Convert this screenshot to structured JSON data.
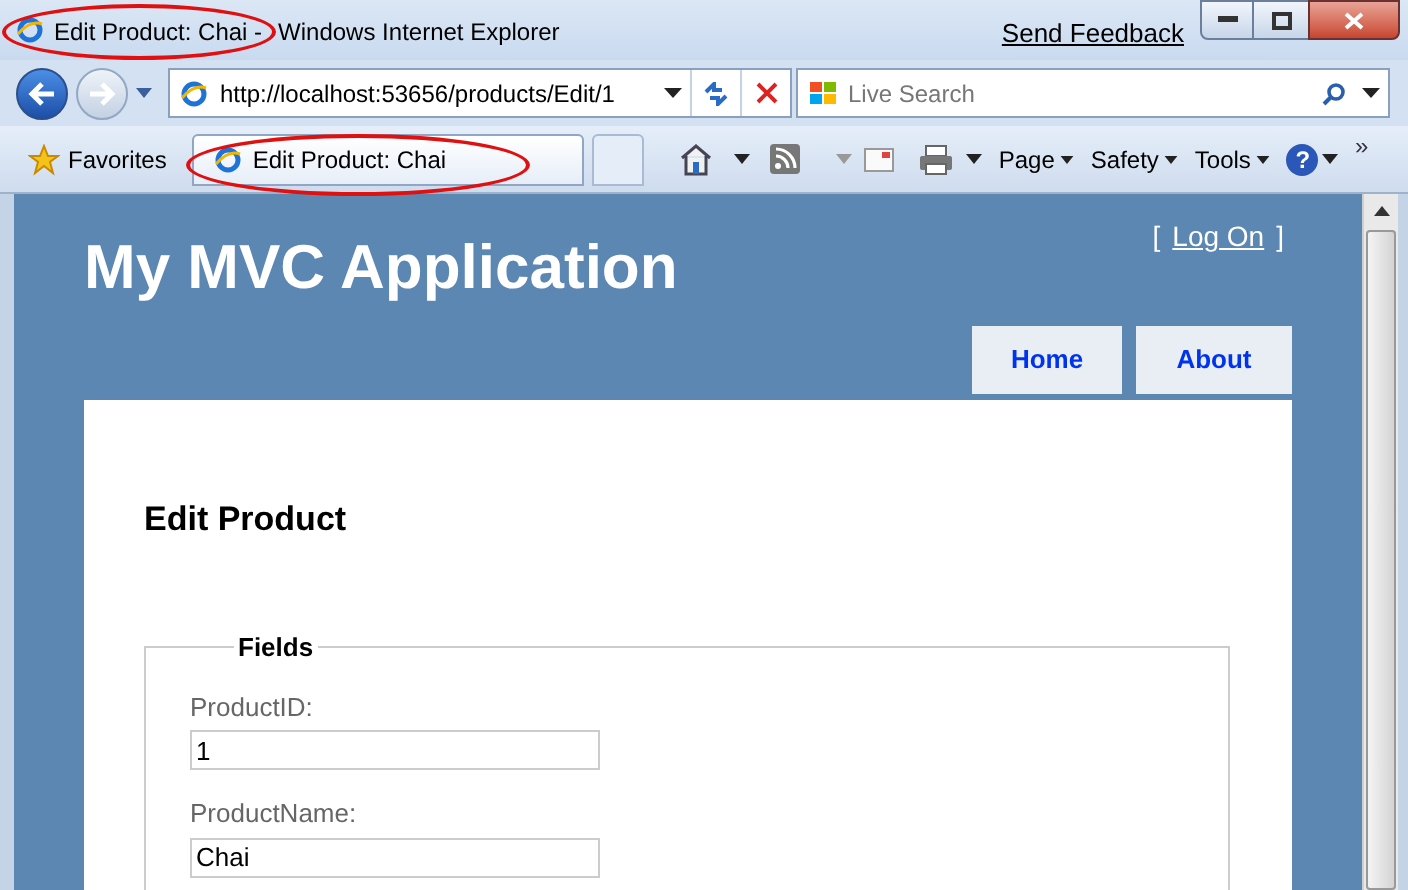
{
  "window": {
    "title": [
      "Edit Product: Chai -",
      "Windows Internet Explorer"
    ],
    "send_feedback": "Send Feedback"
  },
  "address_bar": {
    "url": "http://localhost:53656/products/Edit/1"
  },
  "search": {
    "placeholder": "Live Search"
  },
  "favorites_bar": {
    "favorites": "Favorites",
    "tabs": [
      {
        "label": "Edit Product: Chai",
        "selected": true
      }
    ],
    "menus": [
      "Page",
      "Safety",
      "Tools"
    ],
    "help": "?",
    "more": "»"
  },
  "page": {
    "site_title": "My MVC Application",
    "login": {
      "open": "[",
      "link": "Log On",
      "close": "]"
    },
    "menu": [
      {
        "label": "Home"
      },
      {
        "label": "About"
      }
    ],
    "heading": "Edit Product",
    "fieldset": {
      "legend": "Fields",
      "fields": [
        {
          "label": "ProductID:",
          "value": "1"
        },
        {
          "label": "ProductName:",
          "value": "Chai"
        }
      ]
    }
  }
}
